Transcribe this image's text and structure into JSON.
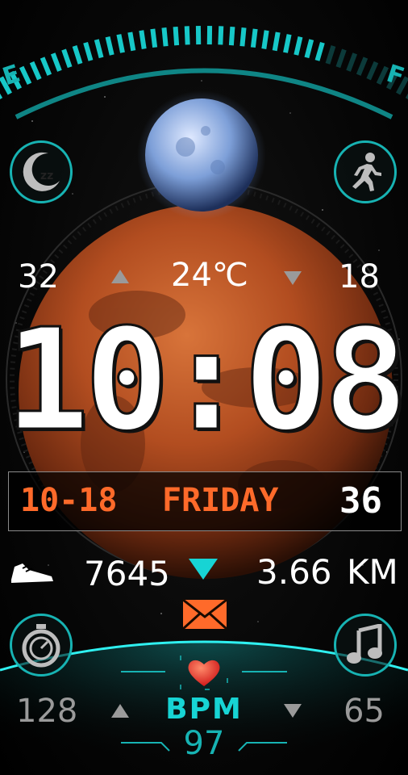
{
  "fuel_gauge": {
    "empty_label": "E",
    "full_label": "F",
    "level": 0.78
  },
  "weather": {
    "high": "32",
    "current": "24℃",
    "low": "18"
  },
  "time": {
    "display": "10:08"
  },
  "date_bar": {
    "date": "10-18",
    "weekday": "FRIDAY",
    "week_number": "36"
  },
  "activity": {
    "steps": "7645",
    "distance": "3.66",
    "distance_unit": "KM"
  },
  "heart": {
    "label": "BPM",
    "current": "97",
    "max": "128",
    "min": "65"
  },
  "icons": {
    "sleep": "sleep-moon-icon",
    "run": "running-person-icon",
    "shoe": "shoe-icon",
    "mail": "mail-icon",
    "stopwatch": "stopwatch-icon",
    "music": "music-note-icon",
    "heart": "heart-icon"
  },
  "colors": {
    "accent": "#17d4d4",
    "date": "#ff6a2a",
    "text": "#ffffff",
    "muted": "#9a9a9a"
  }
}
